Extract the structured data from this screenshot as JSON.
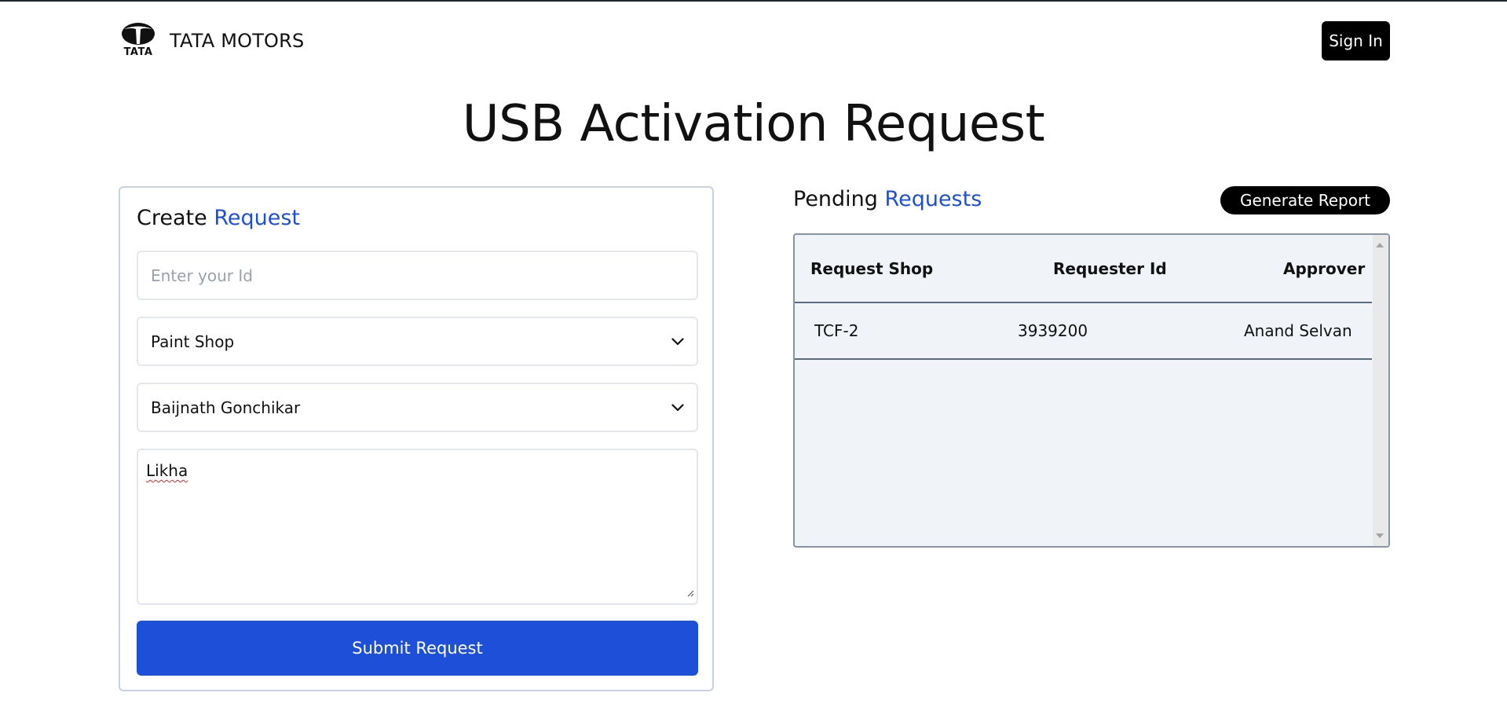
{
  "header": {
    "logo_word": "TATA",
    "brand_name": "TATA MOTORS",
    "signin_label": "Sign In"
  },
  "page": {
    "title": "USB Activation Request"
  },
  "create_request": {
    "heading_plain": "Create",
    "heading_accent": "Request",
    "id_field": {
      "placeholder": "Enter your Id",
      "value": ""
    },
    "shop_select": {
      "value": "Paint Shop"
    },
    "approver_select": {
      "value": "Baijnath Gonchikar"
    },
    "reason_textarea": {
      "value": "Likha"
    },
    "submit_label": "Submit Request"
  },
  "pending_requests": {
    "heading_plain": "Pending",
    "heading_accent": "Requests",
    "generate_report_label": "Generate Report",
    "columns": [
      "Request Shop",
      "Requester Id",
      "Approver"
    ],
    "rows": [
      {
        "shop": "TCF-2",
        "requester_id": "3939200",
        "approver": "Anand Selvan"
      }
    ]
  },
  "colors": {
    "accent": "#1e4fd8",
    "button_dark": "#000000",
    "table_bg": "#f0f3f7"
  },
  "icons": [
    "tata-logo-icon",
    "chevron-down-icon",
    "resize-grip-icon",
    "scroll-up-icon",
    "scroll-down-icon"
  ]
}
